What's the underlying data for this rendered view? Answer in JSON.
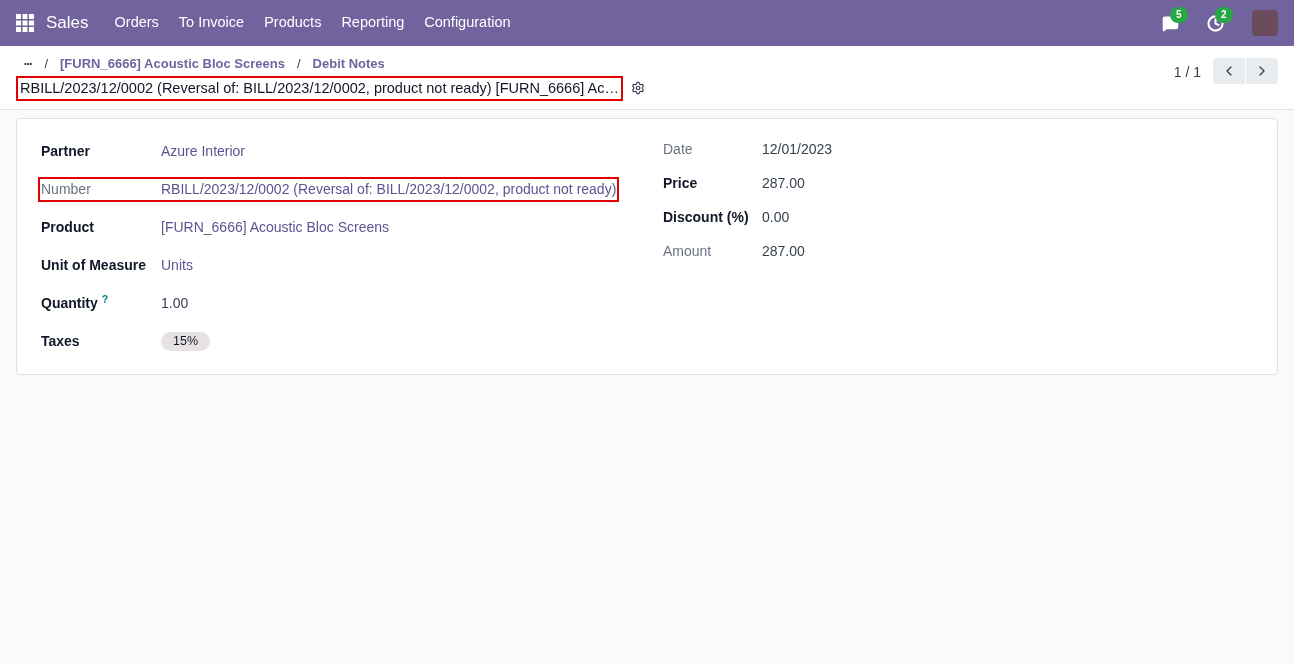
{
  "navbar": {
    "app": "Sales",
    "menu": [
      "Orders",
      "To Invoice",
      "Products",
      "Reporting",
      "Configuration"
    ],
    "messages_badge": "5",
    "activities_badge": "2"
  },
  "breadcrumbs": {
    "ellipsis": "•••",
    "separator": "/",
    "items": [
      "[FURN_6666] Acoustic Bloc Screens",
      "Debit Notes"
    ]
  },
  "title": {
    "text": "RBILL/2023/12/0002 (Reversal of: BILL/2023/12/0002, product not ready) [FURN_6666] Ac…",
    "highlighted": true
  },
  "pager": {
    "value": "1 / 1"
  },
  "left_fields": [
    {
      "label": "Partner",
      "value": "Azure Interior",
      "readonly": false,
      "link": true,
      "highlighted": false,
      "kind": "text"
    },
    {
      "label": "Number",
      "value": "RBILL/2023/12/0002 (Reversal of: BILL/2023/12/0002, product not ready)",
      "readonly": true,
      "link": true,
      "highlighted": true,
      "kind": "text"
    },
    {
      "label": "Product",
      "value": "[FURN_6666] Acoustic Bloc Screens",
      "readonly": false,
      "link": true,
      "highlighted": false,
      "kind": "text"
    },
    {
      "label": "Unit of Measure",
      "value": "Units",
      "readonly": false,
      "link": true,
      "highlighted": false,
      "kind": "text"
    },
    {
      "label": "Quantity",
      "help": "?",
      "value": "1.00",
      "readonly": false,
      "link": false,
      "highlighted": false,
      "kind": "text"
    },
    {
      "label": "Taxes",
      "value": "15%",
      "readonly": false,
      "link": false,
      "highlighted": false,
      "kind": "tag"
    }
  ],
  "right_fields": [
    {
      "label": "Date",
      "value": "12/01/2023",
      "readonly": true
    },
    {
      "label": "Price",
      "value": "287.00",
      "readonly": false
    },
    {
      "label": "Discount (%)",
      "value": "0.00",
      "readonly": false
    },
    {
      "label": "Amount",
      "value": "287.00",
      "readonly": true
    }
  ]
}
